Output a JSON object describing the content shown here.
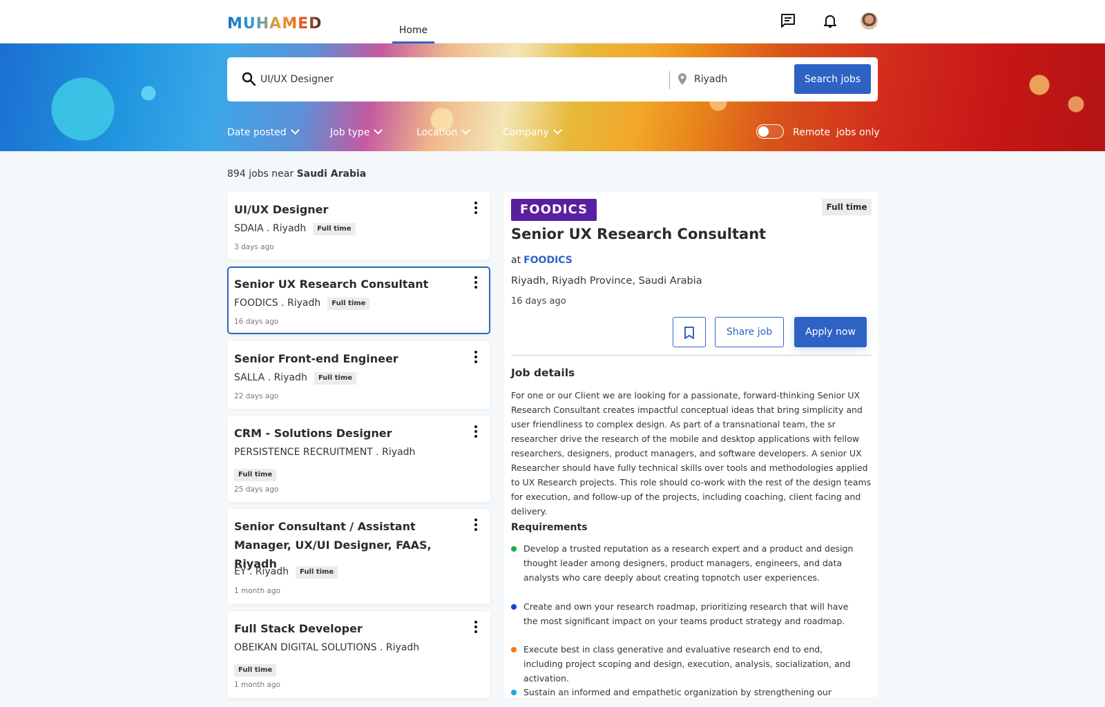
{
  "brand": {
    "logo_text": "MUHAMED"
  },
  "nav": {
    "home_label": "Home"
  },
  "header_icons": [
    "message-icon",
    "bell-icon",
    "avatar"
  ],
  "search": {
    "query": "UI/UX Designer",
    "location": "Riyadh",
    "button_label": "Search jobs"
  },
  "filters": {
    "date_posted": "Date posted",
    "job_type": "Job type",
    "location": "Location",
    "company": "Company",
    "remote_label": "Remote  jobs only",
    "remote_on": false
  },
  "results": {
    "count": "894",
    "near_text": "jobs near",
    "region": "Saudi Arabia"
  },
  "jobs": [
    {
      "title": "UI/UX Designer",
      "company_location": "SDAIA . Riyadh",
      "type": "Full time",
      "age": "3 days ago"
    },
    {
      "title": "Senior UX Research Consultant",
      "company_location": "FOODICS . Riyadh",
      "type": "Full time",
      "age": "16 days ago"
    },
    {
      "title": "Senior Front-end Engineer",
      "company_location": "SALLA . Riyadh",
      "type": "Full time",
      "age": "22 days ago"
    },
    {
      "title": "CRM - Solutions Designer",
      "company_location": "PERSISTENCE RECRUITMENT . Riyadh",
      "type": "Full time",
      "age": "25 days ago"
    },
    {
      "title": "Senior Consultant / Assistant Manager, UX/UI Designer, FAAS, Riyadh",
      "company_location": "EY . Riyadh",
      "type": "Full time",
      "age": "1 month ago"
    },
    {
      "title": "Full Stack Developer",
      "company_location": "OBEIKAN DIGITAL SOLUTIONS . Riyadh",
      "type": "Full time",
      "age": "1 month ago"
    }
  ],
  "detail": {
    "company_logo_text": "FOODICS",
    "type": "Full time",
    "title": "Senior UX Research Consultant",
    "at_label": "at",
    "company": "FOODICS",
    "location": "Riyadh, Riyadh Province, Saudi Arabia",
    "age": "16 days ago",
    "share_label": "Share job",
    "apply_label": "Apply now",
    "job_details_heading": "Job details",
    "description": "For one or our Client we are looking for a passionate, forward-thinking Senior UX Research Consultant creates impactful conceptual ideas that bring simplicity and user friendliness to complex design. As part of a transnational team, the sr researcher drive the research of the mobile and desktop applications with fellow researchers, designers, product managers, and software developers. A senior UX Researcher should have fully technical skills over tools and methodologies applied to UX Research projects. This role should co-work with the rest of the design teams for execution, and follow-up of the projects, including coaching, client facing and delivery.",
    "requirements_heading": "Requirements",
    "requirements": [
      {
        "text": "Develop a trusted reputation as a research expert and a product and design thought leader among designers, product managers, engineers, and data analysts who care deeply about creating topnotch user experiences.",
        "color": "#1ea84a"
      },
      {
        "text": "Create and own your research roadmap, prioritizing research that will have the most significant impact on your teams product strategy and roadmap.",
        "color": "#1a3fd6"
      },
      {
        "text": "Execute best in class generative and evaluative research end to end, including project scoping and design, execution, analysis, socialization, and activation.",
        "color": "#f07a1a"
      },
      {
        "text": "Sustain an informed and empathetic organization by strengthening our",
        "color": "#1aa6e8"
      }
    ]
  },
  "colors": {
    "accent": "#2e63c4",
    "foodics_purple": "#5a1fa0"
  }
}
